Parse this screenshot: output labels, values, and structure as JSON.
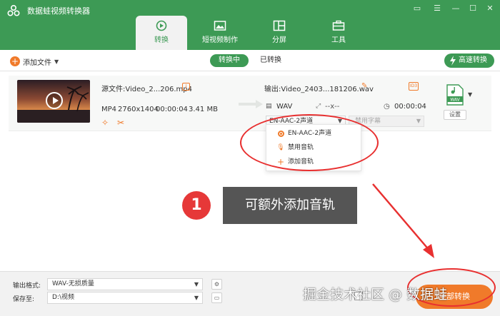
{
  "app": {
    "title": "数据蛙视频转换器"
  },
  "window_controls": [
    "chat-icon",
    "menu-icon",
    "minimize-icon",
    "maximize-icon",
    "close-icon"
  ],
  "tabs": [
    {
      "label": "转换",
      "icon": "convert-icon",
      "active": true
    },
    {
      "label": "短视频制作",
      "icon": "image-icon",
      "active": false
    },
    {
      "label": "分屏",
      "icon": "split-screen-icon",
      "active": false
    },
    {
      "label": "工具",
      "icon": "toolbox-icon",
      "active": false
    }
  ],
  "toolbar": {
    "add_file": "添加文件",
    "converting": "转换中",
    "converted": "已转换",
    "fast_convert": "高速转换"
  },
  "file": {
    "source_label": "源文件:",
    "source_name": "Video_2...206.mp4",
    "format": "MP4",
    "resolution": "2760x1404",
    "duration": "00:00:04",
    "size": "3.41 MB",
    "output_label": "输出:",
    "output_name": "Video_2403...181206.wav",
    "out_format": "WAV",
    "out_resolution": "--x--",
    "out_duration": "00:00:04",
    "audio_track": "EN-AAC-2声道",
    "subtitle": "禁用字幕",
    "target_format_badge": "WAV",
    "settings": "设置"
  },
  "audio_menu": {
    "items": [
      "EN-AAC-2声道",
      "禁用音轨",
      "添加音轨"
    ]
  },
  "callout": {
    "step": "1",
    "text": "可额外添加音轨"
  },
  "bottom": {
    "output_format_label": "输出格式:",
    "output_format_value": "WAV-无损质量",
    "save_to_label": "保存至:",
    "save_to_value": "D:\\视频",
    "convert_all": "全部转换"
  },
  "watermark": "掘金技术社区 @ 数据蛙",
  "colors": {
    "brand_green": "#3d9a55",
    "accent_orange": "#f07a2a",
    "annotation_red": "#e83030"
  }
}
